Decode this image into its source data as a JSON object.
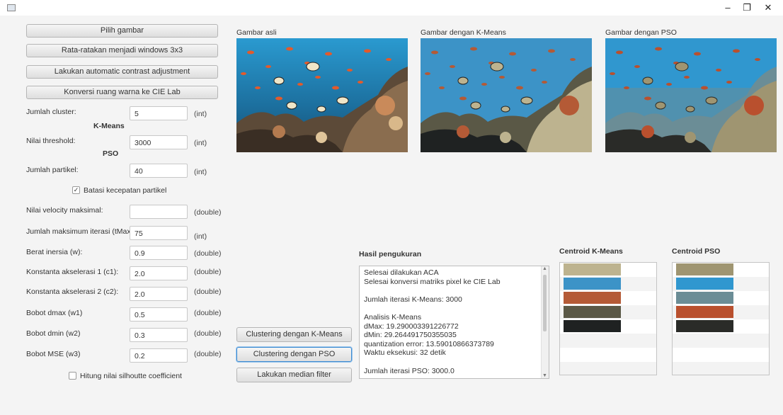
{
  "window": {
    "minimize_glyph": "–",
    "maximize_glyph": "❐",
    "close_glyph": "✕"
  },
  "buttons": {
    "pilih_gambar": "Pilih gambar",
    "rata_ratakan": "Rata-ratakan menjadi windows 3x3",
    "contrast": "Lakukan automatic contrast adjustment",
    "konversi": "Konversi ruang warna ke CIE Lab",
    "clustering_kmeans": "Clustering dengan K-Means",
    "clustering_pso": "Clustering dengan PSO",
    "median_filter": "Lakukan median filter"
  },
  "form": {
    "jumlah_cluster": {
      "label": "Jumlah cluster:",
      "value": "5",
      "unit": "(int)"
    },
    "section_kmeans": "K-Means",
    "nilai_threshold": {
      "label": "Nilai threshold:",
      "value": "3000",
      "unit": "(int)"
    },
    "section_pso": "PSO",
    "jumlah_partikel": {
      "label": "Jumlah partikel:",
      "value": "40",
      "unit": "(int)"
    },
    "batasi_kecepatan": {
      "label": "Batasi kecepatan partikel",
      "checked": true
    },
    "velocity_maks": {
      "label": "Nilai velocity maksimal:",
      "value": "",
      "unit": "(double)"
    },
    "iterasi_maks": {
      "label": "Jumlah maksimum iterasi (tMax):",
      "value": "75",
      "unit": "(int)"
    },
    "berat_inersia": {
      "label": "Berat inersia (w):",
      "value": "0.9",
      "unit": "(double)"
    },
    "c1": {
      "label": "Konstanta akselerasi 1 (c1):",
      "value": "2.0",
      "unit": "(double)"
    },
    "c2": {
      "label": "Konstanta akselerasi 2 (c2):",
      "value": "2.0",
      "unit": "(double)"
    },
    "w1": {
      "label": "Bobot dmax (w1)",
      "value": "0.5",
      "unit": "(double)"
    },
    "w2": {
      "label": "Bobot dmin (w2)",
      "value": "0.3",
      "unit": "(double)"
    },
    "w3": {
      "label": "Bobot MSE (w3)",
      "value": "0.2",
      "unit": "(double)"
    },
    "silhouette": {
      "label": "Hitung nilai silhoutte coefficient",
      "checked": false
    }
  },
  "images": {
    "original": "Gambar asli",
    "kmeans": "Gambar dengan K-Means",
    "pso": "Gambar dengan PSO"
  },
  "results": {
    "title": "Hasil pengukuran",
    "lines": [
      "Selesai dilakukan ACA",
      "Selesai konversi matriks pixel ke CIE Lab",
      "",
      "Jumlah iterasi K-Means: 3000",
      "",
      "Analisis K-Means",
      "dMax: 19.290003391226772",
      "dMin: 29.264491750355035",
      "quantization error: 13.59010866373789",
      "Waktu eksekusi: 32 detik",
      "",
      "Jumlah iterasi PSO: 3000.0"
    ]
  },
  "centroids": {
    "kmeans_title": "Centroid K-Means",
    "pso_title": "Centroid PSO",
    "kmeans_colors": [
      "#bdb38f",
      "#3c93c7",
      "#b45a36",
      "#5a5846",
      "#1f2222"
    ],
    "pso_colors": [
      "#9f9571",
      "#3097cf",
      "#6b8d96",
      "#b9502e",
      "#2a2b28"
    ],
    "panel_rows": 8
  }
}
